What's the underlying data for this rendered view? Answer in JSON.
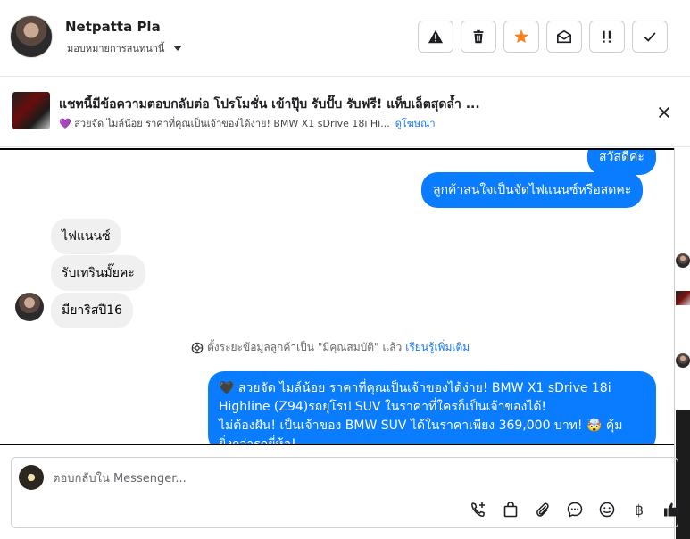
{
  "contact": {
    "name": "Netpatta Pla",
    "assign_label": "มอบหมายการสนทนานี้"
  },
  "ad": {
    "title": "แชทนี้มีข้อความตอบกลับต่อ โปรโมชั่น เข้าปุ๊บ รับปั๊บ รับฟรี! แท็บเล็ตสุดล้ำ ...",
    "subtitle": "💜 สวยจัด ไมล์น้อย ราคาที่คุณเป็นเจ้าของได้ง่าย! BMW X1 sDrive 18i Hi...",
    "link": "ดูโฆษณา"
  },
  "messages": [
    {
      "side": "out",
      "text": "สวัสดีค่ะ"
    },
    {
      "side": "out",
      "text": "ลูกค้าสนใจเป็นจัดไฟแนนซ์หรือสดคะ"
    },
    {
      "side": "in",
      "text": "ไฟแนนซ์"
    },
    {
      "side": "in",
      "text": "รับเทรินมั๊ยคะ"
    },
    {
      "side": "in",
      "text": "มียาริสปี16"
    }
  ],
  "system_note": {
    "text": "ตั้งระยะข้อมูลลูกค้าเป็น \"มีคุณสมบัติ\" แล้ว",
    "link": "เรียนรู้เพิ่มเติม"
  },
  "long_message": {
    "line1": "🖤 สวยจัด ไมล์น้อย ราคาที่คุณเป็นเจ้าของได้ง่าย! BMW X1 sDrive 18i",
    "line2": "Highline (Z94)รถยุโรป SUV ในราคาที่ใครก็เป็นเจ้าของได้!",
    "line3": "ไม่ต้องฝัน! เป็นเจ้าของ BMW SUV ได้ในราคาเพียง 369,000 บาท! 🤯 คุ้ม",
    "line4": "ยิ่งกว่ารถยี่ห้อ!"
  },
  "composer": {
    "placeholder": "ตอบกลับใน Messenger...",
    "currency_symbol": "฿"
  },
  "colors": {
    "outgoing": "#0a7cff",
    "incoming": "#f0f0f0",
    "star": "#f5821f"
  }
}
